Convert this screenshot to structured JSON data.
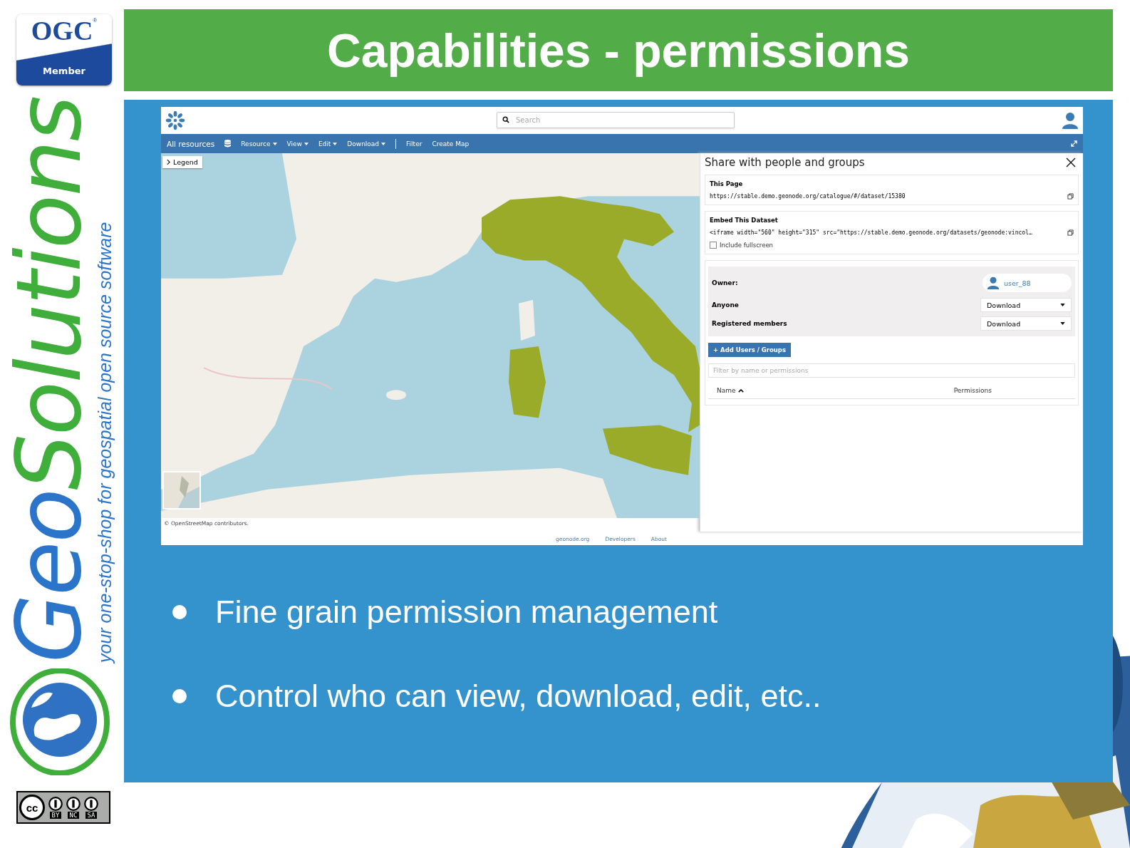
{
  "slide": {
    "title": "Capabilities - permissions",
    "bullets": [
      "Fine grain permission management",
      "Control who can view, download, edit, etc.."
    ]
  },
  "ogc_badge": {
    "name": "OGC",
    "mark": "®",
    "caption": "Member"
  },
  "brand": {
    "name": [
      "Geo",
      "Solutions"
    ],
    "tagline": "your one-stop-shop for geospatial open source software"
  },
  "license_badge": {
    "symbol": "cc",
    "terms": [
      "BY",
      "NC",
      "SA"
    ]
  },
  "app": {
    "search": {
      "placeholder": "Search"
    },
    "menu": [
      {
        "kind": "link",
        "label": "All resources"
      },
      {
        "kind": "icon"
      },
      {
        "kind": "dropdown",
        "label": "Resource"
      },
      {
        "kind": "dropdown",
        "label": "View"
      },
      {
        "kind": "dropdown",
        "label": "Edit"
      },
      {
        "kind": "dropdown",
        "label": "Download"
      },
      {
        "kind": "separator"
      },
      {
        "kind": "link",
        "label": "Filter"
      },
      {
        "kind": "link",
        "label": "Create Map"
      }
    ],
    "map": {
      "legend_button": "Legend",
      "attribution": "© OpenStreetMap contributors."
    },
    "share_panel": {
      "title": "Share with people and groups",
      "this_page": {
        "label": "This Page",
        "url": "https://stable.demo.geonode.org/catalogue/#/dataset/15380"
      },
      "embed": {
        "label": "Embed This Dataset",
        "code": "<iframe width=\"560\" height=\"315\" src=\"https://stable.demo.geonode.org/datasets/geonode:vincol…",
        "include_fullscreen": {
          "label": "Include fullscreen",
          "checked": false
        }
      },
      "owner": {
        "label": "Owner:",
        "user": "user_88"
      },
      "permissions": [
        {
          "label": "Anyone",
          "value": "Download"
        },
        {
          "label": "Registered members",
          "value": "Download"
        }
      ],
      "add_button": "+ Add Users / Groups",
      "filter": {
        "placeholder": "Filter by name or permissions"
      },
      "columns": [
        {
          "label": "Name",
          "sorted": true
        },
        {
          "label": "Permissions",
          "sorted": false
        }
      ]
    },
    "footer_links": [
      "geonode.org",
      "Developers",
      "About"
    ]
  }
}
